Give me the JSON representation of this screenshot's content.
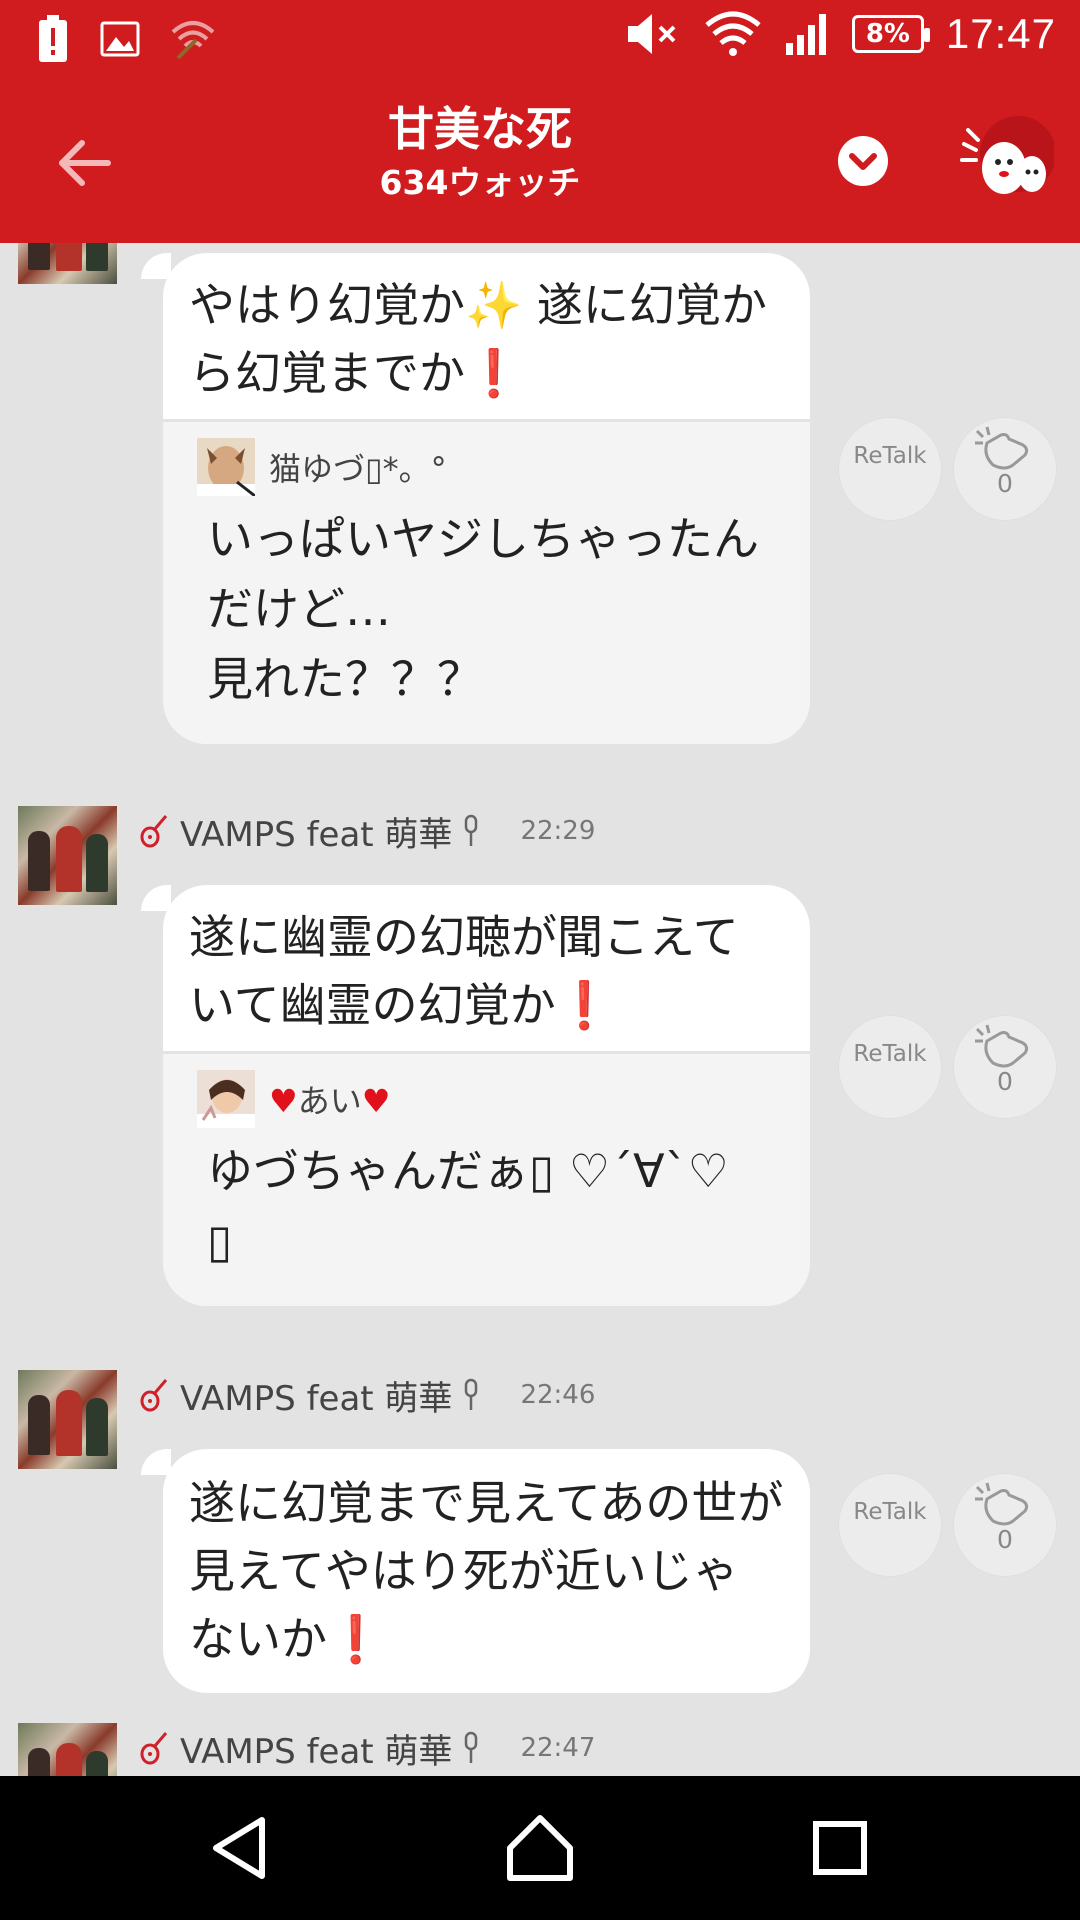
{
  "status_bar": {
    "time": "17:47",
    "battery": "8%",
    "icons": [
      "battery-alert-icon",
      "image-icon",
      "wifi-off-icon",
      "mute-icon",
      "wifi-icon",
      "signal-icon"
    ]
  },
  "header": {
    "title": "甘美な死",
    "subtitle": "634ウォッチ",
    "back_icon": "arrow-left-icon",
    "dropdown_icon": "chevron-down-icon",
    "mascot_icon": "mascot-icon"
  },
  "actions": {
    "retalk_label": "ReTalk"
  },
  "messages": [
    {
      "text": "やはり幻覚か✨ 遂に幻覚から幻覚までか",
      "excl": "❗",
      "quote": {
        "name": "猫ゆづ▯*。°",
        "text": "いっぱいヤジしちゃったんだけど…\n見れた？？？"
      },
      "claps": "0"
    },
    {
      "author": "VAMPS feat 萌華",
      "time": "22:29",
      "text": "遂に幽霊の幻聴が聞こえていて幽霊の幻覚か",
      "excl": "❗",
      "quote": {
        "heart_left": "♥",
        "name": "あい",
        "heart_right": "♥",
        "text": "ゆづちゃんだぁ▯ ♡´∀`♡\n▯"
      },
      "claps": "0"
    },
    {
      "author": "VAMPS feat 萌華",
      "time": "22:46",
      "text": "遂に幻覚まで見えてあの世が見えてやはり死が近いじゃないか",
      "excl": "❗",
      "claps": "0"
    },
    {
      "author": "VAMPS feat 萌華",
      "time": "22:47"
    }
  ],
  "nav": {
    "back_icon": "nav-back-icon",
    "home_icon": "nav-home-icon",
    "recents_icon": "nav-recents-icon"
  }
}
